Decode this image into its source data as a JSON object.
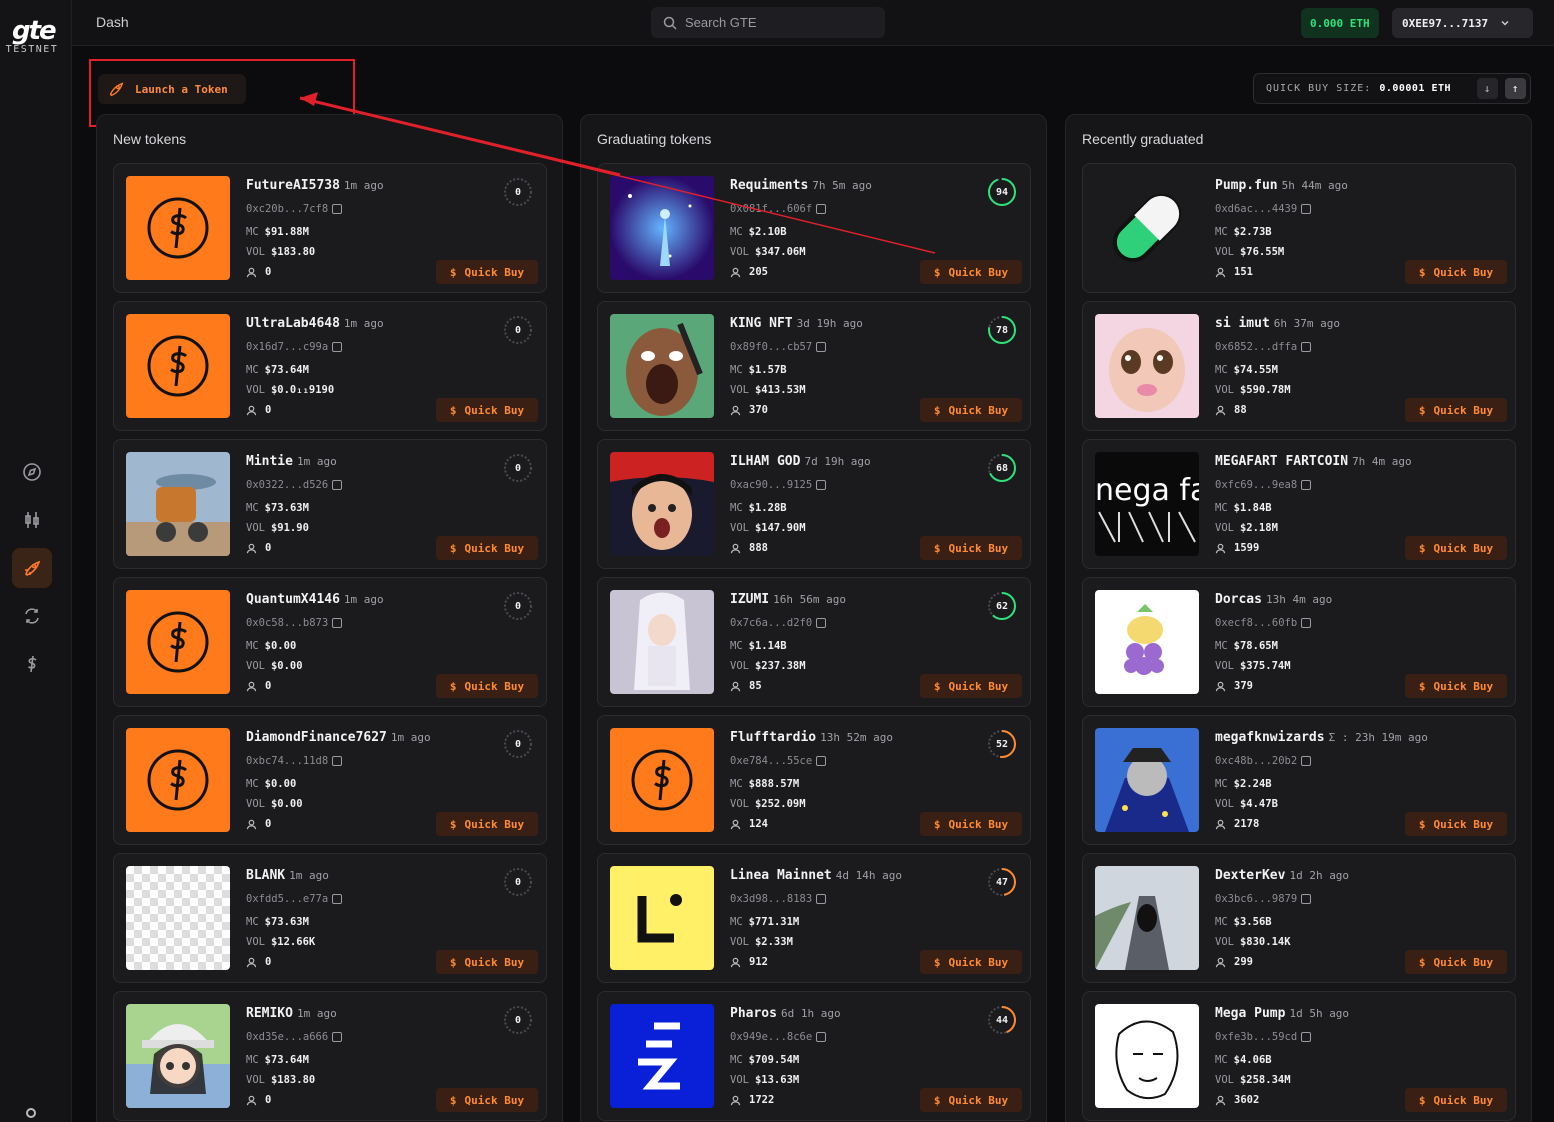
{
  "app": {
    "logo": "gte",
    "network": "TESTNET",
    "page_title": "Dash",
    "search_placeholder": "Search GTE",
    "balance": "0.000 ETH",
    "wallet": "0XEE97...7137"
  },
  "sidebar": {
    "items": [
      {
        "icon": "compass-icon",
        "active": false
      },
      {
        "icon": "candlestick-icon",
        "active": false
      },
      {
        "icon": "rocket-icon",
        "active": true
      },
      {
        "icon": "swap-icon",
        "active": false
      },
      {
        "icon": "dollar-icon",
        "active": false
      }
    ]
  },
  "launch_label": "Launch a Token",
  "quick_buy_size": {
    "label": "QUICK BUY SIZE:",
    "value": "0.00001 ETH"
  },
  "quick_buy_label": "Quick Buy",
  "colors": {
    "accent": "#ff7a1a",
    "green": "#2ee27a"
  },
  "columns": [
    {
      "title": "New tokens",
      "cards": [
        {
          "name": "FutureAI5738",
          "age": "1m ago",
          "address": "0xc20b...7cf8",
          "mc": "$91.88M",
          "vol": "$183.80",
          "holders": "0",
          "progress": "0",
          "image": "dollar"
        },
        {
          "name": "UltraLab4648",
          "age": "1m ago",
          "address": "0x16d7...c99a",
          "mc": "$73.64M",
          "vol": "$0.0₁₁9190",
          "holders": "0",
          "progress": "0",
          "image": "dollar"
        },
        {
          "name": "Mintie",
          "age": "1m ago",
          "address": "0x0322...d526",
          "mc": "$73.63M",
          "vol": "$91.90",
          "holders": "0",
          "progress": "0",
          "image": "mech"
        },
        {
          "name": "QuantumX4146",
          "age": "1m ago",
          "address": "0x0c58...b873",
          "mc": "$0.00",
          "vol": "$0.00",
          "holders": "0",
          "progress": "0",
          "image": "dollar"
        },
        {
          "name": "DiamondFinance7627",
          "age": "1m ago",
          "address": "0xbc74...11d8",
          "mc": "$0.00",
          "vol": "$0.00",
          "holders": "0",
          "progress": "0",
          "image": "dollar"
        },
        {
          "name": "BLANK",
          "age": "1m ago",
          "address": "0xfdd5...e77a",
          "mc": "$73.63M",
          "vol": "$12.66K",
          "holders": "0",
          "progress": "0",
          "image": "checker"
        },
        {
          "name": "REMIKO",
          "age": "1m ago",
          "address": "0xd35e...a666",
          "mc": "$73.64M",
          "vol": "$183.80",
          "holders": "0",
          "progress": "0",
          "image": "anime"
        }
      ]
    },
    {
      "title": "Graduating tokens",
      "cards": [
        {
          "name": "Requiments",
          "age": "7h 5m ago",
          "address": "0x081f...606f",
          "mc": "$2.10B",
          "vol": "$347.06M",
          "holders": "205",
          "progress": "94",
          "image": "galaxy"
        },
        {
          "name": "KING NFT",
          "age": "3d 19h ago",
          "address": "0x89f0...cb57",
          "mc": "$1.57B",
          "vol": "$413.53M",
          "holders": "370",
          "progress": "78",
          "image": "face"
        },
        {
          "name": "ILHAM GOD",
          "age": "7d 19h ago",
          "address": "0xac90...9125",
          "mc": "$1.28B",
          "vol": "$147.90M",
          "holders": "888",
          "progress": "68",
          "image": "kid"
        },
        {
          "name": "IZUMI",
          "age": "16h 56m ago",
          "address": "0x7c6a...d2f0",
          "mc": "$1.14B",
          "vol": "$237.38M",
          "holders": "85",
          "progress": "62",
          "image": "cosplay"
        },
        {
          "name": "Flufftardio",
          "age": "13h 52m ago",
          "address": "0xe784...55ce",
          "mc": "$888.57M",
          "vol": "$252.09M",
          "holders": "124",
          "progress": "52",
          "image": "dollar"
        },
        {
          "name": "Linea Mainnet",
          "age": "4d 14h ago",
          "address": "0x3d98...8183",
          "mc": "$771.31M",
          "vol": "$2.33M",
          "holders": "912",
          "progress": "47",
          "image": "linea"
        },
        {
          "name": "Pharos",
          "age": "6d 1h ago",
          "address": "0x949e...8c6e",
          "mc": "$709.54M",
          "vol": "$13.63M",
          "holders": "1722",
          "progress": "44",
          "image": "pharos"
        }
      ]
    },
    {
      "title": "Recently graduated",
      "cards": [
        {
          "name": "Pump.fun",
          "age": "5h 44m ago",
          "address": "0xd6ac...4439",
          "mc": "$2.73B",
          "vol": "$76.55M",
          "holders": "151",
          "image": "pill"
        },
        {
          "name": "si imut",
          "age": "6h 37m ago",
          "address": "0x6852...dffa",
          "mc": "$74.55M",
          "vol": "$590.78M",
          "holders": "88",
          "image": "cat"
        },
        {
          "name": "MEGAFART FARTCOIN",
          "age": "7h 4m ago",
          "address": "0xfc69...9ea8",
          "mc": "$1.84B",
          "vol": "$2.18M",
          "holders": "1599",
          "image": "megafart"
        },
        {
          "name": "Dorcas",
          "age": "13h 4m ago",
          "address": "0xecf8...60fb",
          "mc": "$78.65M",
          "vol": "$375.74M",
          "holders": "379",
          "image": "grape"
        },
        {
          "name": "megafknwizards",
          "age": "Σ : 23h 19m ago",
          "address": "0xc48b...20b2",
          "mc": "$2.24B",
          "vol": "$4.47B",
          "holders": "2178",
          "image": "wizard"
        },
        {
          "name": "DexterKev",
          "age": "1d 2h ago",
          "address": "0x3bc6...9879",
          "mc": "$3.56B",
          "vol": "$830.14K",
          "holders": "299",
          "image": "bear"
        },
        {
          "name": "Mega Pump",
          "age": "1d 5h ago",
          "address": "0xfe3b...59cd",
          "mc": "$4.06B",
          "vol": "$258.34M",
          "holders": "3602",
          "image": "wojak"
        }
      ]
    }
  ],
  "labels": {
    "mc": "MC",
    "vol": "VOL"
  }
}
